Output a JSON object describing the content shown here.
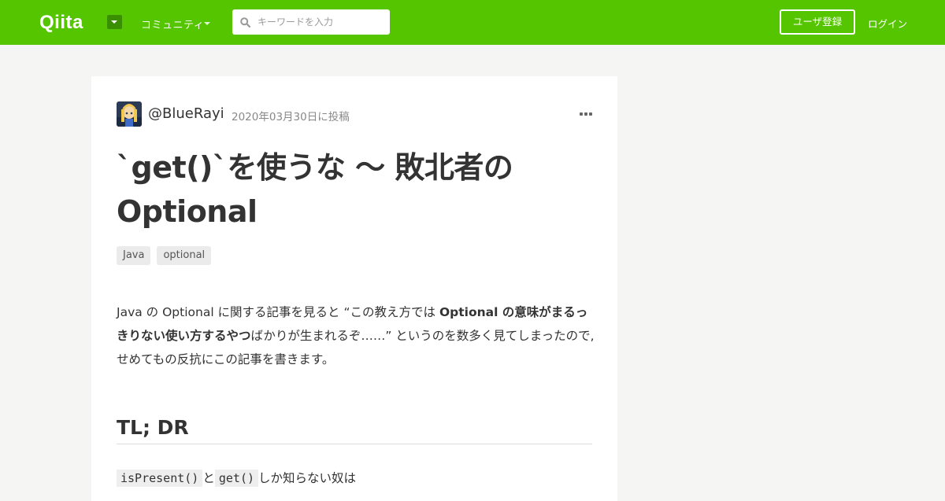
{
  "header": {
    "logo_text": "Qiita",
    "community_label": "コミュニティ",
    "search_placeholder": "キーワードを入力",
    "signup_label": "ユーザ登録",
    "login_label": "ログイン",
    "brand_color": "#55c500"
  },
  "article": {
    "author": "@BlueRayi",
    "posted_date": "2020年03月30日に投稿",
    "title_line1": "`get()`を使うな ～ 敗北者の",
    "title_line2": "Optional",
    "tags": [
      "Java",
      "optional"
    ],
    "intro_part1": "Java の Optional に関する記事を見ると “この教え方では ",
    "intro_bold": "Optional の意味がまるっきりない使い方するやつ",
    "intro_part2": "ばかりが生まれるぞ……” というのを数多く見てしまったので,せめてもの反抗にこの記事を書きます。",
    "section_heading": "TL; DR",
    "code1": "isPresent()",
    "connector": "と",
    "code2": "get()",
    "line_tail": "しか知らない奴は"
  }
}
